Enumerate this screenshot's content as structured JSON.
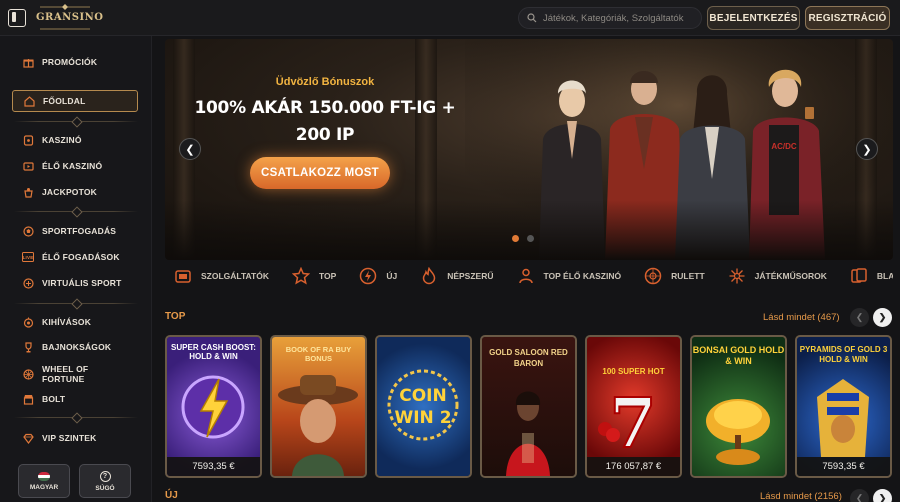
{
  "header": {
    "logo": "GRANSINO",
    "search_placeholder": "Játékok, Kategóriák, Szolgáltatók",
    "login_label": "BEJELENTKEZÉS",
    "register_label": "REGISZTRÁCIÓ"
  },
  "sidebar": {
    "items": [
      {
        "label": "PROMÓCIÓK",
        "icon": "gift-icon"
      },
      {
        "label": "FŐOLDAL",
        "icon": "home-icon",
        "active": true
      },
      {
        "label": "KASZINÓ",
        "icon": "casino-icon"
      },
      {
        "label": "ÉLŐ KASZINÓ",
        "icon": "live-casino-icon"
      },
      {
        "label": "JACKPOTOK",
        "icon": "jackpot-icon"
      },
      {
        "label": "SPORTFOGADÁS",
        "icon": "sports-icon"
      },
      {
        "label": "ÉLŐ FOGADÁSOK",
        "icon": "live-bet-icon"
      },
      {
        "label": "VIRTUÁLIS SPORT",
        "icon": "virtual-sport-icon"
      },
      {
        "label": "KIHÍVÁSOK",
        "icon": "challenge-icon"
      },
      {
        "label": "BAJNOKSÁGOK",
        "icon": "trophy-icon"
      },
      {
        "label": "WHEEL OF FORTUNE",
        "icon": "wheel-icon"
      },
      {
        "label": "BOLT",
        "icon": "shop-icon"
      },
      {
        "label": "VIP SZINTEK",
        "icon": "diamond-icon"
      }
    ],
    "language_label": "MAGYAR",
    "help_label": "SÚGÓ"
  },
  "hero": {
    "subtitle": "Üdvözlő Bónuszok",
    "title": "100% AKÁR 150.000 FT-IG + 200 IP",
    "cta": "CSATLAKOZZ MOST"
  },
  "categories": [
    {
      "label": "SZOLGÁLTATÓK",
      "icon": "providers-icon"
    },
    {
      "label": "TOP",
      "icon": "star-icon"
    },
    {
      "label": "ÚJ",
      "icon": "new-icon"
    },
    {
      "label": "NÉPSZERŰ",
      "icon": "fire-icon"
    },
    {
      "label": "TOP ÉLŐ KASZINÓ",
      "icon": "live-dealer-icon"
    },
    {
      "label": "RULETT",
      "icon": "roulette-icon"
    },
    {
      "label": "JÁTÉKMŰSOROK",
      "icon": "gameshow-icon"
    },
    {
      "label": "BLACKJAC",
      "icon": "cards-icon"
    }
  ],
  "top_section": {
    "title": "TOP",
    "see_all": "Lásd mindet (467)",
    "games": [
      {
        "title": "SUPER CASH BOOST: HOLD & WIN",
        "price": "7593,35 €",
        "accent": "#6a3fb0"
      },
      {
        "title": "BOOK OF RA BUY BONUS",
        "price": "",
        "accent": "#c96a1e"
      },
      {
        "title": "COIN WIN 2",
        "price": "",
        "accent": "#1f4d8f",
        "badge": "U"
      },
      {
        "title": "GOLD SALOON RED BARON",
        "price": "",
        "accent": "#7a1616",
        "badge": "U"
      },
      {
        "title": "100 SUPER HOT",
        "price": "176 057,87 €",
        "accent": "#b01818",
        "badge": "U"
      },
      {
        "title": "BONSAI GOLD HOLD & WIN",
        "price": "",
        "accent": "#1e5a24",
        "badge": "U"
      },
      {
        "title": "PYRAMIDS OF GOLD 3 HOLD & WIN",
        "price": "7593,35 €",
        "accent": "#1c3f8a"
      }
    ]
  },
  "next_section": {
    "title": "ÚJ",
    "see_all": "Lásd mindet (2156)"
  }
}
